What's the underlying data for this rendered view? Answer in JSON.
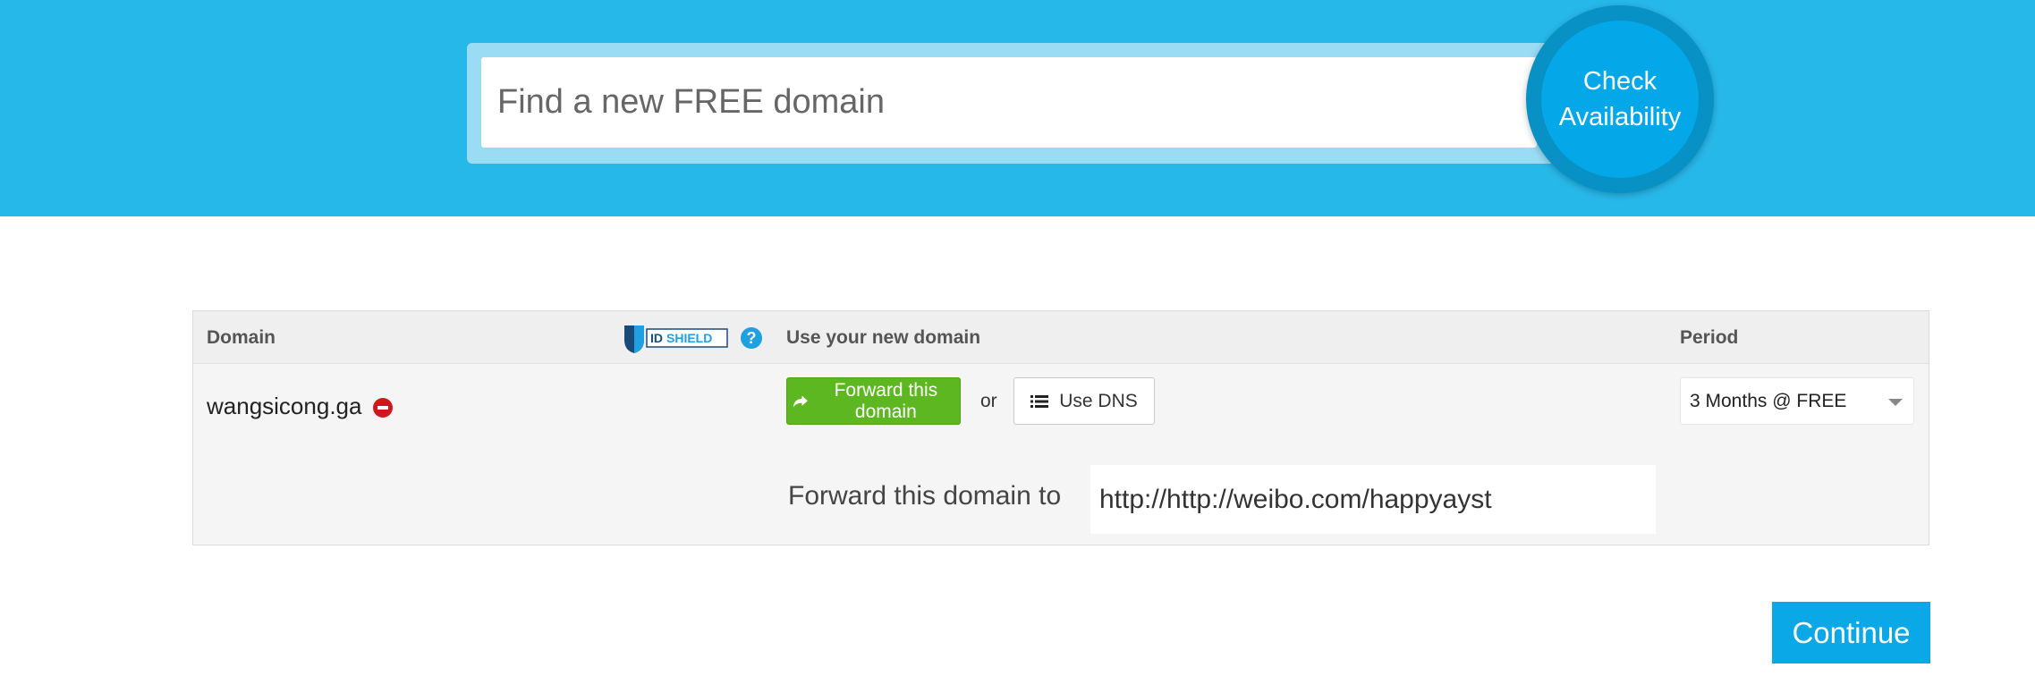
{
  "header": {
    "search": {
      "placeholder": "Find a new FREE domain",
      "value": ""
    },
    "check_button_label": "Check Availability"
  },
  "table": {
    "columns": {
      "domain": "Domain",
      "idshield_logo_text": "IDSHIELD",
      "use": "Use your new domain",
      "period": "Period"
    },
    "row": {
      "domain_name": "wangsicong.ga",
      "forward_button_label": "Forward this domain",
      "or_text": "or",
      "dns_button_label": "Use DNS",
      "period_value": "3 Months @ FREE",
      "forward_label": "Forward this domain to",
      "forward_url": "http://http://weibo.com/happyayst"
    }
  },
  "footer": {
    "continue_label": "Continue"
  },
  "colors": {
    "band": "#27b8ea",
    "accent": "#04a8e8",
    "forward_green": "#5db721",
    "remove_red": "#d0171b"
  }
}
